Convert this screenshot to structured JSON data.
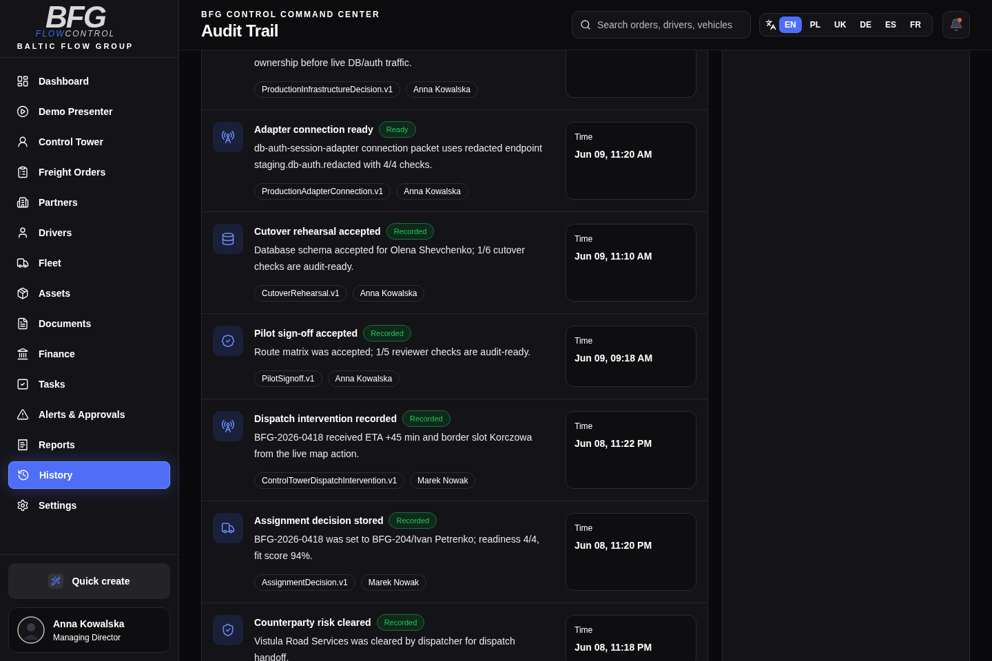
{
  "brand": {
    "logo_main": "BFG",
    "logo_flow": "FLOW",
    "logo_control": "CONTROL",
    "tagline": "BALTIC FLOW GROUP"
  },
  "nav": [
    {
      "label": "Dashboard",
      "selected": false
    },
    {
      "label": "Demo Presenter",
      "selected": false
    },
    {
      "label": "Control Tower",
      "selected": false
    },
    {
      "label": "Freight Orders",
      "selected": false
    },
    {
      "label": "Partners",
      "selected": false
    },
    {
      "label": "Drivers",
      "selected": false
    },
    {
      "label": "Fleet",
      "selected": false
    },
    {
      "label": "Assets",
      "selected": false
    },
    {
      "label": "Documents",
      "selected": false
    },
    {
      "label": "Finance",
      "selected": false
    },
    {
      "label": "Tasks",
      "selected": false
    },
    {
      "label": "Alerts & Approvals",
      "selected": false
    },
    {
      "label": "Reports",
      "selected": false
    },
    {
      "label": "History",
      "selected": true
    },
    {
      "label": "Settings",
      "selected": false
    }
  ],
  "quick_create": "Quick create",
  "user": {
    "name": "Anna Kowalska",
    "role": "Managing Director"
  },
  "header": {
    "eyebrow": "BFG CONTROL COMMAND CENTER",
    "title": "Audit Trail",
    "search_placeholder": "Search orders, drivers, vehicles"
  },
  "languages": [
    {
      "label": "EN",
      "selected": true
    },
    {
      "label": "PL",
      "selected": false
    },
    {
      "label": "UK",
      "selected": false
    },
    {
      "label": "DE",
      "selected": false
    },
    {
      "label": "ES",
      "selected": false
    },
    {
      "label": "FR",
      "selected": false
    }
  ],
  "notifications": {
    "unread": true
  },
  "partial_event": {
    "description": "ownership before live DB/auth traffic.",
    "tags": [
      "ProductionInfrastructureDecision.v1",
      "Anna Kowalska"
    ]
  },
  "events": [
    {
      "title": "Adapter connection ready",
      "status": "Ready",
      "description": "db-auth-session-adapter connection packet uses redacted endpoint staging.db-auth.redacted with 4/4 checks.",
      "tags": [
        "ProductionAdapterConnection.v1",
        "Anna Kowalska"
      ],
      "time_label": "Time",
      "time": "Jun 09, 11:20 AM"
    },
    {
      "title": "Cutover rehearsal accepted",
      "status": "Recorded",
      "description": "Database schema accepted for Olena Shevchenko; 1/6 cutover checks are audit-ready.",
      "tags": [
        "CutoverRehearsal.v1",
        "Anna Kowalska"
      ],
      "time_label": "Time",
      "time": "Jun 09, 11:10 AM"
    },
    {
      "title": "Pilot sign-off accepted",
      "status": "Recorded",
      "description": "Route matrix was accepted; 1/5 reviewer checks are audit-ready.",
      "tags": [
        "PilotSignoff.v1",
        "Anna Kowalska"
      ],
      "time_label": "Time",
      "time": "Jun 09, 09:18 AM"
    },
    {
      "title": "Dispatch intervention recorded",
      "status": "Recorded",
      "description": "BFG-2026-0418 received ETA +45 min and border slot Korczowa from the live map action.",
      "tags": [
        "ControlTowerDispatchIntervention.v1",
        "Marek Nowak"
      ],
      "time_label": "Time",
      "time": "Jun 08, 11:22 PM"
    },
    {
      "title": "Assignment decision stored",
      "status": "Recorded",
      "description": "BFG-2026-0418 was set to BFG-204/Ivan Petrenko; readiness 4/4, fit score 94%.",
      "tags": [
        "AssignmentDecision.v1",
        "Marek Nowak"
      ],
      "time_label": "Time",
      "time": "Jun 08, 11:20 PM"
    },
    {
      "title": "Counterparty risk cleared",
      "status": "Recorded",
      "description": "Vistula Road Services was cleared by dispatcher for dispatch handoff.",
      "time_label": "Time",
      "time": "Jun 08, 11:18 PM"
    }
  ]
}
